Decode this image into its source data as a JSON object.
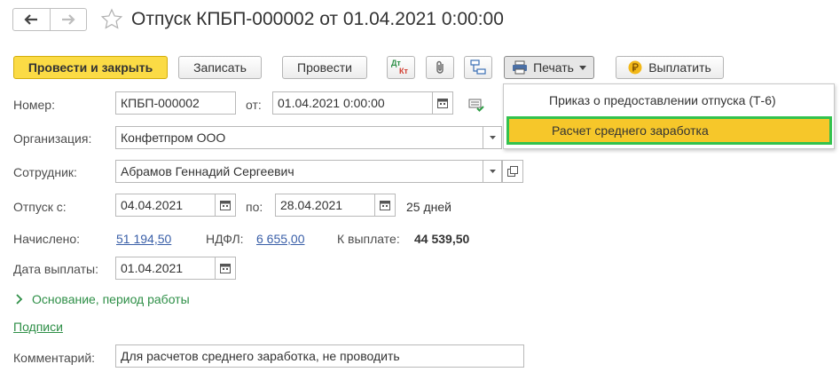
{
  "window": {
    "title": "Отпуск КПБП-000002 от 01.04.2021 0:00:00"
  },
  "toolbar": {
    "post_close_label": "Провести и закрыть",
    "save_label": "Записать",
    "post_label": "Провести",
    "dtkt_top": "Дт",
    "dtkt_bottom": "Кт",
    "print_label": "Печать",
    "pay_label": "Выплатить"
  },
  "print_menu": {
    "items": [
      "Приказ о предоставлении отпуска (Т-6)",
      "Расчет среднего заработка"
    ],
    "selected_index": 1
  },
  "form": {
    "number_label": "Номер:",
    "number_value": "КПБП-000002",
    "from_label": "от:",
    "date_value": "01.04.2021  0:00:00",
    "org_label": "Организация:",
    "org_value": "Конфетпром ООО",
    "employee_label": "Сотрудник:",
    "employee_value": "Абрамов Геннадий Сергеевич",
    "vacation_from_label": "Отпуск с:",
    "vacation_from_value": "04.04.2021",
    "vacation_to_label": "по:",
    "vacation_to_value": "28.04.2021",
    "days_text": "25 дней",
    "accrued_label": "Начислено:",
    "accrued_value": "51 194,50",
    "ndfl_label": "НДФЛ:",
    "ndfl_value": "6 655,00",
    "to_pay_label": "К выплате:",
    "to_pay_value": "44 539,50",
    "pay_date_label": "Дата выплаты:",
    "pay_date_value": "01.04.2021",
    "basis_section_label": "Основание, период работы",
    "signatures_link": "Подписи",
    "comment_label": "Комментарий:",
    "comment_value": "Для расчетов среднего заработка, не проводить"
  },
  "colors": {
    "primary_button": "#fbdb45",
    "selected_menu_item": "#f6c72a",
    "selected_menu_border": "#33c24d",
    "link": "#3a5fa8",
    "section_green": "#2e8f47"
  }
}
